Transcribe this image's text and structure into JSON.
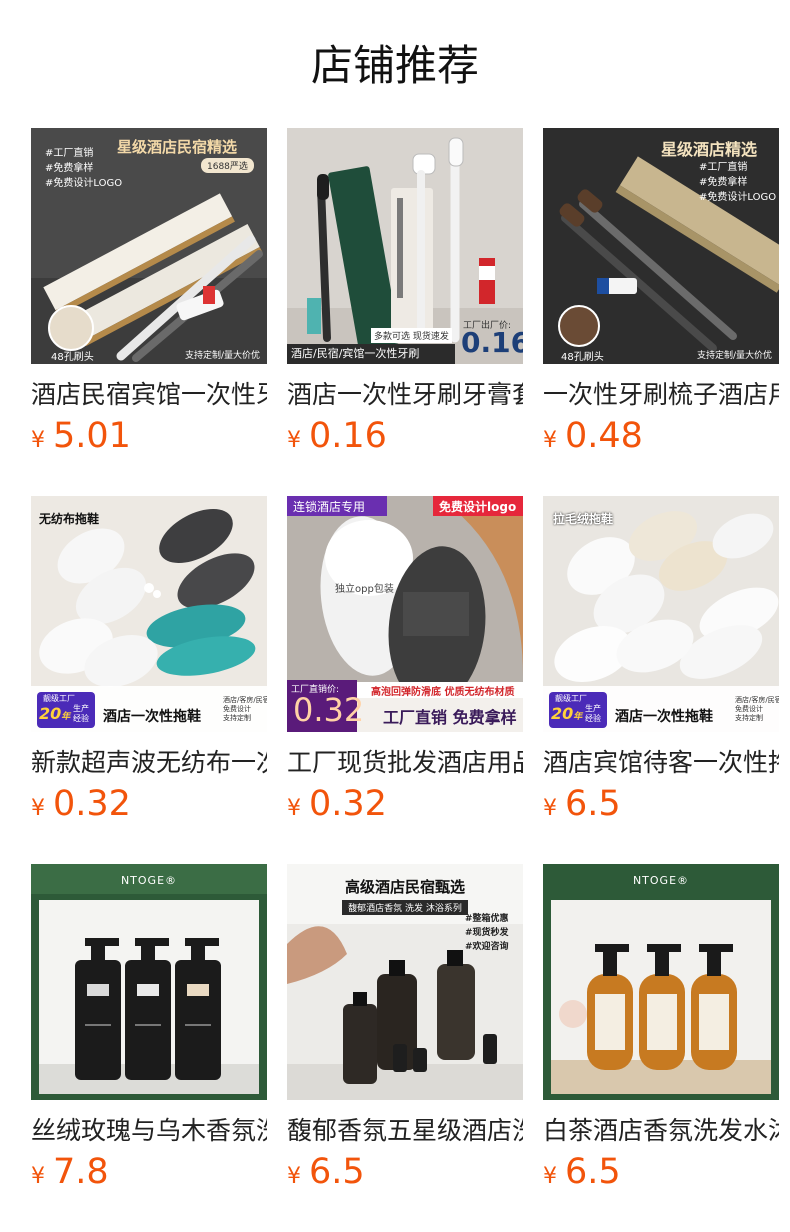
{
  "section_title": "店铺推荐",
  "currency_symbol": "¥",
  "products": [
    {
      "name": "酒店民宿宾馆一次性牙刷",
      "price": "5.01",
      "image": {
        "banner": "星级酒店民宿精选",
        "tags": [
          "#工厂直销",
          "#免费拿样",
          "#免费设计LOGO"
        ],
        "badge": "1688严选",
        "foot_left": "48孔刷头",
        "foot_right": "支持定制/量大价优"
      }
    },
    {
      "name": "酒店一次性牙刷牙膏套装",
      "price": "0.16",
      "image": {
        "promo": "多款可选 现货速发",
        "price_label": "工厂出厂价:",
        "price_big": "0.16",
        "price_unit": "¥",
        "caption": "酒店/民宿/宾馆一次性牙刷"
      }
    },
    {
      "name": "一次性牙刷梳子酒店用品",
      "price": "0.48",
      "image": {
        "banner": "星级酒店精选",
        "tags": [
          "#工厂直销",
          "#免费拿样",
          "#免费设计LOGO"
        ],
        "foot_left": "48孔刷头",
        "foot_right": "支持定制/量大价优"
      }
    },
    {
      "name": "新款超声波无纺布一次性拖鞋",
      "price": "0.32",
      "image": {
        "label": "无纺布拖鞋",
        "factory": "靓级工厂",
        "years": "20",
        "years_unit": "年",
        "years_note": [
          "生产",
          "经验"
        ],
        "caption": "酒店一次性拖鞋",
        "notes": [
          "酒店/客房/民宿",
          "免费设计",
          "支持定制"
        ]
      }
    },
    {
      "name": "工厂现货批发酒店用品拖鞋",
      "price": "0.32",
      "image": {
        "left_tag": "连锁酒店专用",
        "right_tag": "免费设计logo",
        "pack": "独立opp包装",
        "price_label": "工厂直销价:",
        "price_big": "0.32",
        "feature": "高泡回弹防滑底 优质无纺布材质",
        "slogan": "工厂直销 免费拿样"
      }
    },
    {
      "name": "酒店宾馆待客一次性拖鞋",
      "price": "6.5",
      "image": {
        "label": "拉毛绒拖鞋",
        "factory": "靓级工厂",
        "years": "20",
        "years_unit": "年",
        "years_note": [
          "生产",
          "经验"
        ],
        "caption": "酒店一次性拖鞋",
        "notes": [
          "酒店/客房/民宿",
          "免费设计",
          "支持定制"
        ]
      }
    },
    {
      "name": "丝绒玫瑰与乌木香氛洗发水",
      "price": "7.8",
      "image": {
        "brand": "NTOGE®"
      }
    },
    {
      "name": "馥郁香氛五星级酒店洗护套装",
      "price": "6.5",
      "image": {
        "title": "高级酒店民宿甄选",
        "subtitle": "馥郁酒店香氛 洗发 沐浴系列",
        "tags": [
          "#整箱优惠",
          "#现货秒发",
          "#欢迎咨询"
        ]
      }
    },
    {
      "name": "白茶酒店香氛洗发水沐浴露",
      "price": "6.5",
      "image": {
        "brand": "NTOGE®"
      }
    }
  ]
}
